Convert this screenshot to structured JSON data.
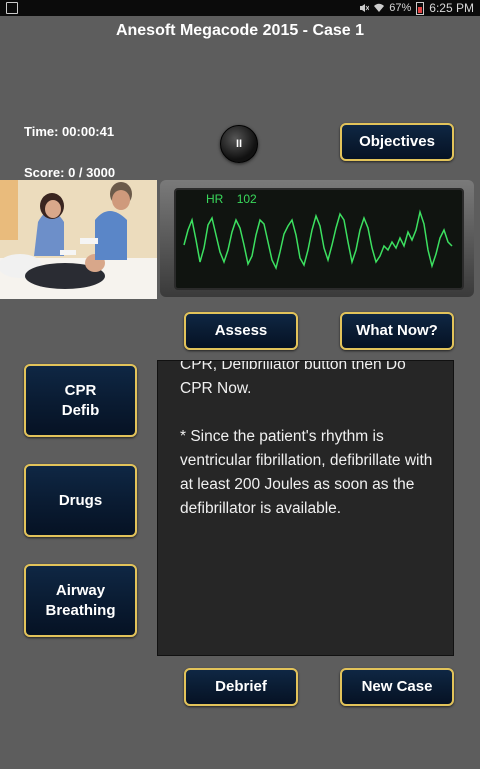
{
  "header": {
    "title": "Anesoft Megacode 2015 - Case 1"
  },
  "status_bar": {
    "battery": "67%",
    "time": "6:25 PM"
  },
  "stats": {
    "time_label": "Time:  00:00:41",
    "score_label": "Score: 0 / 3000"
  },
  "monitor": {
    "hr_label": "HR",
    "hr_value": "102"
  },
  "buttons": {
    "pause": "II",
    "objectives": "Objectives",
    "assess": "Assess",
    "what_now": "What Now?",
    "cpr_defib_line1": "CPR",
    "cpr_defib_line2": "Defib",
    "drugs": "Drugs",
    "airway_line1": "Airway",
    "airway_line2": "Breathing",
    "debrief": "Debrief",
    "new_case": "New Case"
  },
  "message": {
    "partial_line": "CPR, Defibrillator button then Do",
    "line2": "CPR Now.",
    "paragraph": "* Since the patient's rhythm is ventricular fibrillation, defibrillate with at least 200 Joules as soon as the defibrillator is available."
  }
}
